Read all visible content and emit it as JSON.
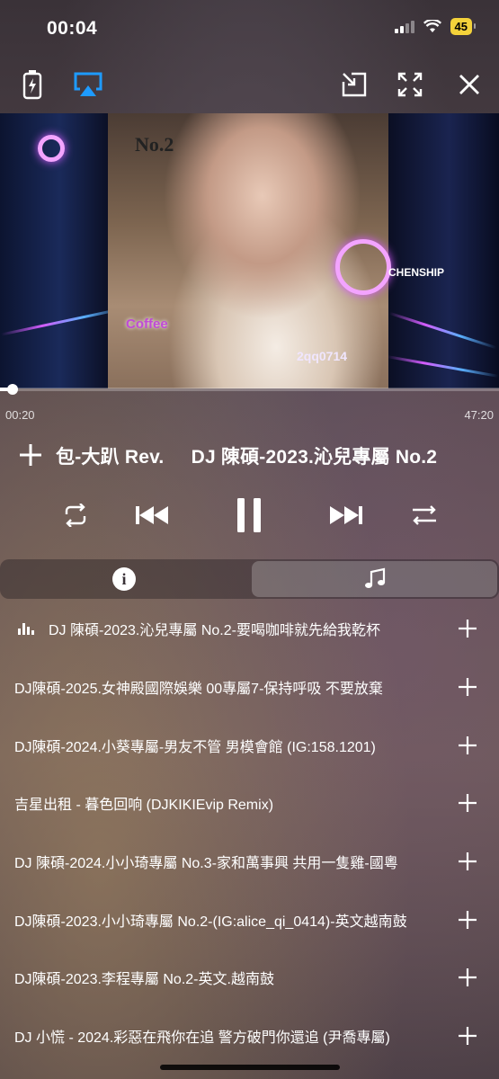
{
  "status_bar": {
    "time": "00:04",
    "battery": "45",
    "battery_color": "#f4d23a"
  },
  "toolbar": {
    "left_icons": [
      "battery-saver-icon",
      "airplay-icon"
    ],
    "right_icons": [
      "picture-in-picture-icon",
      "fullscreen-icon",
      "close-icon"
    ],
    "airplay_color": "#1e9bff"
  },
  "video": {
    "cover_number": "No.2",
    "cover_caption": "2qq0714",
    "cover_brand": "CHENSHIP",
    "cover_coffee": "Coffee"
  },
  "playback": {
    "elapsed": "00:20",
    "duration": "47:20",
    "progress": 0.007
  },
  "now_playing": {
    "marquee_text": "包-大趴 Rev.     DJ 陳碩-2023.沁兒專屬 No.2",
    "add_label": "+"
  },
  "controls": [
    "repeat-icon",
    "previous-icon",
    "pause-icon",
    "next-icon",
    "shuffle-icon"
  ],
  "tabs": {
    "info_label": "i",
    "active": "music"
  },
  "playlist": [
    {
      "title": "DJ 陳碩-2023.沁兒專屬 No.2-要喝咖啡就先給我乾杯",
      "current": true
    },
    {
      "title": "DJ陳碩-2025.女神殿國際娛樂 00專屬7-保持呼吸 不要放棄",
      "current": false
    },
    {
      "title": "DJ陳碩-2024.小葵專屬-男友不管 男模會館 (IG:158.1201)",
      "current": false
    },
    {
      "title": "吉星出租 - 暮色回响 (DJKIKIEvip Remix)",
      "current": false
    },
    {
      "title": "DJ 陳碩-2024.小小琦專屬 No.3-家和萬事興 共用一隻雞-國粵",
      "current": false
    },
    {
      "title": "DJ陳碩-2023.小小琦專屬 No.2-(IG:alice_qi_0414)-英文越南鼓",
      "current": false
    },
    {
      "title": "DJ陳碩-2023.李程專屬 No.2-英文.越南鼓",
      "current": false
    },
    {
      "title": "DJ 小慌 - 2024.彩惡在飛你在追 警方破門你還追 (尹喬專屬)",
      "current": false
    }
  ]
}
